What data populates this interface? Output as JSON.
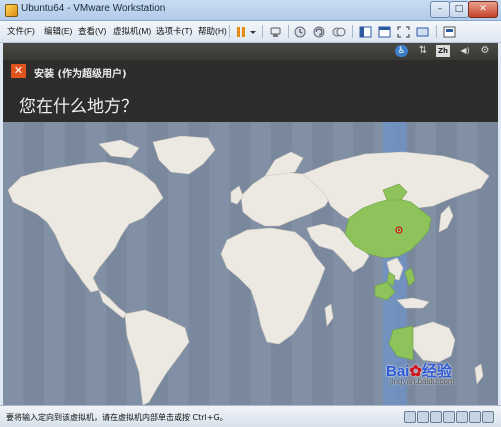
{
  "window": {
    "title": "Ubuntu64 - VMware Workstation",
    "minimize_glyph": "–",
    "maximize_glyph": "□",
    "close_glyph": "✕"
  },
  "menu": {
    "items": [
      {
        "label": "文件(F)"
      },
      {
        "label": "编辑(E)"
      },
      {
        "label": "查看(V)"
      },
      {
        "label": "虚拟机(M)"
      },
      {
        "label": "选项卡(T)"
      },
      {
        "label": "帮助(H)"
      }
    ]
  },
  "toolbar_icons": [
    "pause-icon",
    "dropdown-icon",
    "send-ctrl-alt-del-icon",
    "snapshot-icon",
    "revert-snapshot-icon",
    "manage-snapshot-icon",
    "normal-view-icon",
    "quick-switch-icon",
    "fullscreen-icon",
    "unity-icon",
    "console-view-icon"
  ],
  "guest": {
    "topbar": {
      "accessibility_glyph": "♿",
      "network_glyph": "⇅",
      "keyboard_label": "Zh",
      "volume_glyph": "◀)",
      "settings_glyph": "⚙"
    },
    "installer": {
      "close_glyph": "✕",
      "title": "安装 (作为超级用户)",
      "question": "您在什么地方？"
    },
    "map": {
      "ocean_color": "#7d8ba0",
      "land_color": "#ece9e2",
      "highlight_land_color": "#8dc35a",
      "highlight_zone_color": "#6f93c8",
      "selected_region": "China"
    }
  },
  "status": {
    "text": "要将输入定向到该虚拟机，请在虚拟机内部单击或按 Ctrl+G。"
  },
  "watermark": {
    "brand": "Bai",
    "brand_tail": "经验",
    "sub": "jingyan.baidu.com"
  }
}
